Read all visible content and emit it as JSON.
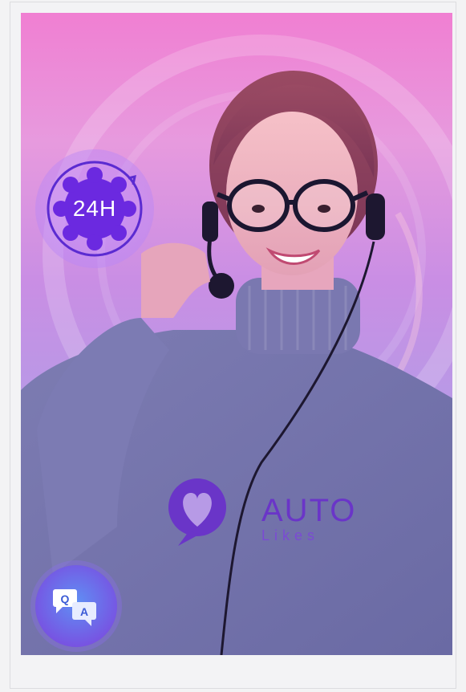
{
  "badge": {
    "label": "24H"
  },
  "brand": {
    "name": "AUTO",
    "sub": "Likes"
  },
  "colors": {
    "accent": "#7a4de0",
    "background_top": "#f07fd2",
    "background_bottom": "#9aa3e3"
  },
  "icons": {
    "clock_badge": "clock-24-icon",
    "qa_badge": "qa-chat-icon",
    "logo": "heart-bubble-logo"
  }
}
